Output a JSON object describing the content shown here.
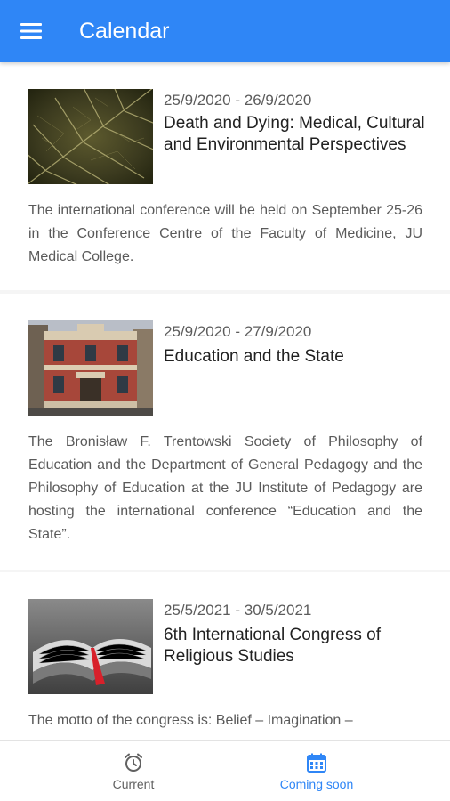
{
  "app": {
    "title": "Calendar",
    "menu_icon": "hamburger-menu-icon"
  },
  "colors": {
    "primary": "#2f86f6",
    "inactive_nav": "#616161",
    "active_nav": "#2f86f6"
  },
  "events": [
    {
      "dates": "25/9/2020 - 26/9/2020",
      "title": "Death and Dying: Medical, Cultural and Environmental Perspectives",
      "description": "The international conference will be held on September 25-26 in the Conference Centre of the Faculty of Medicine, JU Medical College.",
      "image": "dried-leaf-photo"
    },
    {
      "dates": "25/9/2020 - 27/9/2020",
      "title": "Education and the State",
      "description": "The Bronisław F. Trentowski Society of Philosophy of Education and the Department of General Pedagogy and the Philosophy of Education at the JU Institute of Pedagogy are hosting the international conference “Education and the State”.",
      "image": "historic-building-photo"
    },
    {
      "dates": "25/5/2021 - 30/5/2021",
      "title": "6th International Congress of Religious Studies",
      "description": "The motto of the congress is: Belief – Imagination –",
      "image": "open-book-photo"
    }
  ],
  "bottom_nav": [
    {
      "label": "Current",
      "icon": "alarm-clock-icon",
      "active": false
    },
    {
      "label": "Coming soon",
      "icon": "calendar-icon",
      "active": true
    }
  ]
}
